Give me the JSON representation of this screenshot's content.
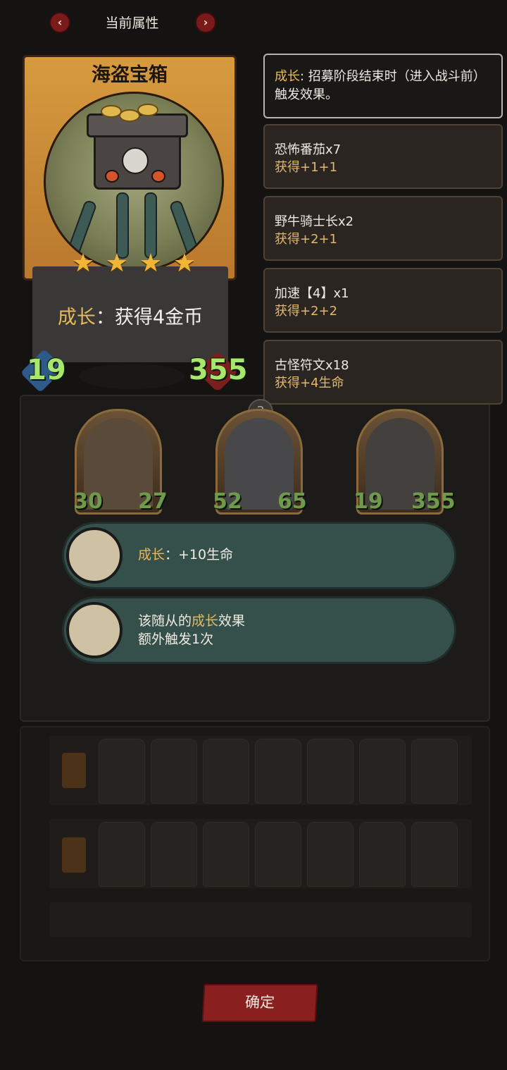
{
  "header": {
    "title": "当前属性",
    "prev_icon": "chevron-left-icon",
    "next_icon": "chevron-right-icon",
    "prev_glyph": "‹",
    "next_glyph": "›"
  },
  "card": {
    "name": "海盗宝箱",
    "stars": 4,
    "effect_keyword": "成长",
    "effect_text": "：获得4金币",
    "attack": "19",
    "health": "355"
  },
  "info": {
    "keyword": "成长",
    "description": ": 招募阶段结束时（进入战斗前）触发效果。",
    "items": [
      {
        "name": "恐怖番茄x7",
        "gain": "获得+1+1"
      },
      {
        "name": "野牛骑士长x2",
        "gain": "获得+2+1"
      },
      {
        "name": "加速【4】x1",
        "gain": "获得+2+2"
      },
      {
        "name": "古怪符文x18",
        "gain": "获得+4生命"
      }
    ]
  },
  "board": {
    "tier": "3",
    "minions": [
      {
        "attack": "30",
        "health": "27"
      },
      {
        "attack": "52",
        "health": "65"
      },
      {
        "attack": "19",
        "health": "355"
      }
    ]
  },
  "tooltips": [
    {
      "icon": "tombstone-icon",
      "keyword": "成长",
      "text": "：+10生命"
    },
    {
      "icon": "stopwatch-gauntlet-icon",
      "prefix": "该随从的",
      "keyword": "成长",
      "suffix": "效果",
      "line2": "额外触发1次"
    }
  ],
  "confirm_label": "确定",
  "star_glyph": "★"
}
